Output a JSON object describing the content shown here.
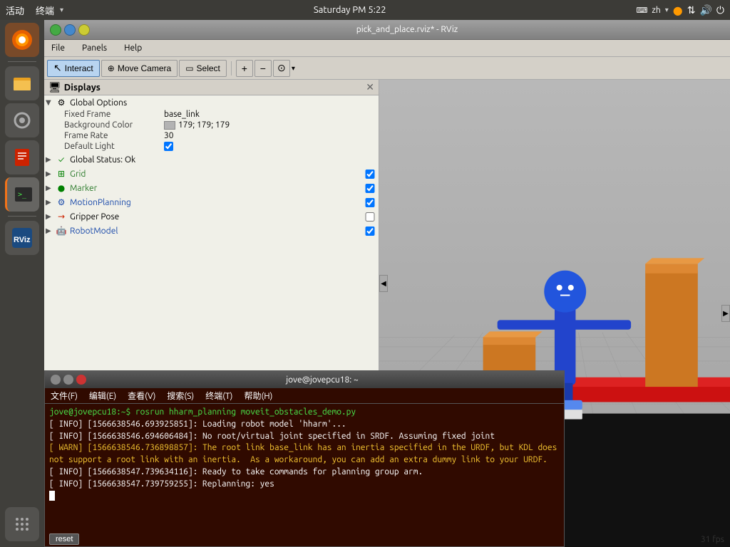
{
  "taskbar": {
    "activities": "活动",
    "terminal_label": "终端",
    "datetime": "Saturday PM 5:22",
    "lang": "zh",
    "icons": [
      "keyboard",
      "network",
      "volume",
      "power"
    ]
  },
  "rviz": {
    "title": "pick_and_place.rviz* - RViz",
    "menu": {
      "file": "File",
      "panels": "Panels",
      "help": "Help"
    },
    "toolbar": {
      "interact": "Interact",
      "move_camera": "Move Camera",
      "select": "Select"
    },
    "displays": {
      "title": "Displays",
      "global_options": {
        "label": "Global Options",
        "fixed_frame_label": "Fixed Frame",
        "fixed_frame_value": "base_link",
        "bg_color_label": "Background Color",
        "bg_color_value": "179; 179; 179",
        "frame_rate_label": "Frame Rate",
        "frame_rate_value": "30",
        "default_light_label": "Default Light",
        "default_light_checked": true
      },
      "global_status": {
        "label": "Global Status: Ok"
      },
      "items": [
        {
          "name": "Grid",
          "color": "green",
          "icon": "grid",
          "checked": true
        },
        {
          "name": "Marker",
          "color": "green",
          "icon": "marker",
          "checked": true
        },
        {
          "name": "MotionPlanning",
          "color": "blue",
          "icon": "motion",
          "checked": true
        },
        {
          "name": "Gripper Pose",
          "color": "red",
          "icon": "gripper",
          "checked": false
        },
        {
          "name": "RobotModel",
          "color": "blue",
          "icon": "robot",
          "checked": true
        }
      ]
    }
  },
  "viewport": {
    "fps": "31 fps"
  },
  "terminal": {
    "title": "jove@jovepcu18: ~",
    "menu": {
      "file": "文件(F)",
      "edit": "编辑(E)",
      "view": "查看(V)",
      "search": "搜索(S)",
      "terminal": "终端(T)",
      "help": "帮助(H)"
    },
    "lines": [
      {
        "type": "prompt",
        "text": "jove@jovepcu18:~$ rosrun hharm_planning moveit_obstacles_demo.py"
      },
      {
        "type": "info",
        "text": "[ INFO] [1566638546.693925851]: Loading robot model 'hharm'..."
      },
      {
        "type": "info",
        "text": "[ INFO] [1566638546.694606484]: No root/virtual joint specified in SRDF. Assuming fixed joint"
      },
      {
        "type": "warn",
        "text": "[ WARN] [1566638546.736898857]: The root link base_link has an inertia specified in the URDF, but KDL does not support a root link with an inertia.  As a workaround, you can add an extra dummy link to your URDF."
      },
      {
        "type": "info",
        "text": "[ INFO] [1566638547.739634116]: Ready to take commands for planning group arm."
      },
      {
        "type": "info",
        "text": "[ INFO] [1566638547.739759255]: Replanning: yes"
      }
    ],
    "reset_btn": "reset"
  },
  "sidebar": {
    "apps": [
      "firefox",
      "files",
      "settings",
      "notes",
      "terminal",
      "rviz"
    ]
  }
}
